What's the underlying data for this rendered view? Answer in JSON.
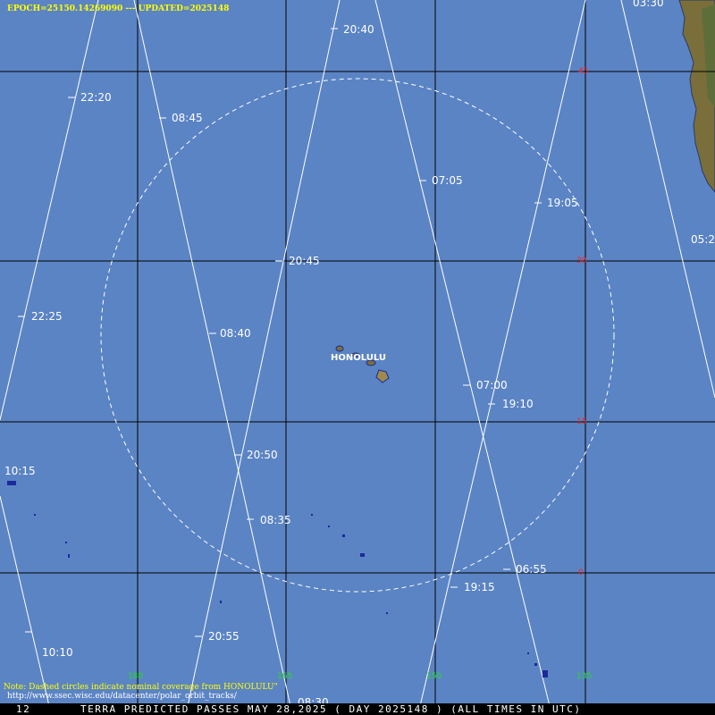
{
  "header": {
    "epoch_line": "EPOCH=25150.14269090 --- UPDATED=2025148"
  },
  "map": {
    "ocean_color": "#5b84c4",
    "grid_color": "#000000",
    "track_color": "#ffffff",
    "coverage_circle_color": "#ffffff",
    "land_color": "#8a7a40",
    "station": {
      "name": "HONOLULU"
    },
    "lat_labels": [
      "45",
      "30",
      "15",
      "0"
    ],
    "lon_labels": [
      "180",
      "165",
      "150",
      "135"
    ],
    "pass_times": [
      "20:40",
      "03:30",
      "22:20",
      "08:45",
      "07:05",
      "19:05",
      "05:2",
      "20:45",
      "22:25",
      "08:40",
      "07:00",
      "19:10",
      "10:15",
      "20:50",
      "08:35",
      "06:55",
      "19:15",
      "10:10",
      "20:55",
      "08:30"
    ]
  },
  "footer": {
    "note": "Note: Dashed circles indicate nominal coverage from HONOLULU\"",
    "url": "http://www.ssec.wisc.edu/datacenter/polar_orbit_tracks/",
    "page_number": "12",
    "status": "TERRA PREDICTED PASSES MAY 28,2025 ( DAY 2025148 ) (ALL TIMES IN UTC)"
  }
}
